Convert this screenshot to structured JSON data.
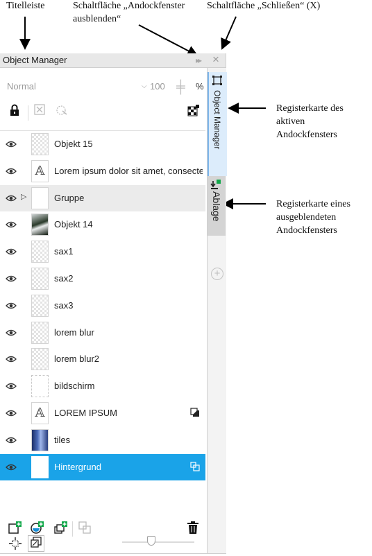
{
  "annotations": {
    "titlebar": "Titelleiste",
    "hide_button": "Schaltfläche „Andockfenster\nausblenden“",
    "close_button": "Schaltfläche „Schließen“ (X)",
    "active_tab": "Registerkarte des\naktiven\nAndockfensters",
    "hidden_tab": "Registerkarte eines\nausgeblendeten\nAndockfensters"
  },
  "docker": {
    "title": "Object Manager",
    "hide_icon": "double-chevron-right-icon",
    "close_icon": "close-icon",
    "blend_mode": "Normal",
    "opacity": "100",
    "opacity_unit": "%"
  },
  "layers": [
    {
      "label": "Objekt 15",
      "thumb": "checker"
    },
    {
      "label": "Lorem ipsum dolor sit amet, consecte...",
      "thumb": "text"
    },
    {
      "label": "Gruppe",
      "thumb": "plain",
      "expandable": true
    },
    {
      "label": "Objekt 14",
      "thumb": "photo"
    },
    {
      "label": "sax1",
      "thumb": "checker"
    },
    {
      "label": "sax2",
      "thumb": "checker"
    },
    {
      "label": "sax3",
      "thumb": "checker"
    },
    {
      "label": "lorem blur",
      "thumb": "checker"
    },
    {
      "label": "lorem blur2",
      "thumb": "checker"
    },
    {
      "label": "bildschirm",
      "thumb": "screen"
    },
    {
      "label": "LOREM IPSUM",
      "thumb": "text",
      "badge": "shadow-icon"
    },
    {
      "label": "tiles",
      "thumb": "tiles"
    },
    {
      "label": "Hintergrund",
      "thumb": "plain",
      "badge": "lock-page-icon",
      "selected": true
    }
  ],
  "tabs": {
    "active": "Object Manager",
    "inactive": "Ablage"
  },
  "colors": {
    "selection": "#1aa3e8",
    "active_tab": "#dcecfb"
  }
}
